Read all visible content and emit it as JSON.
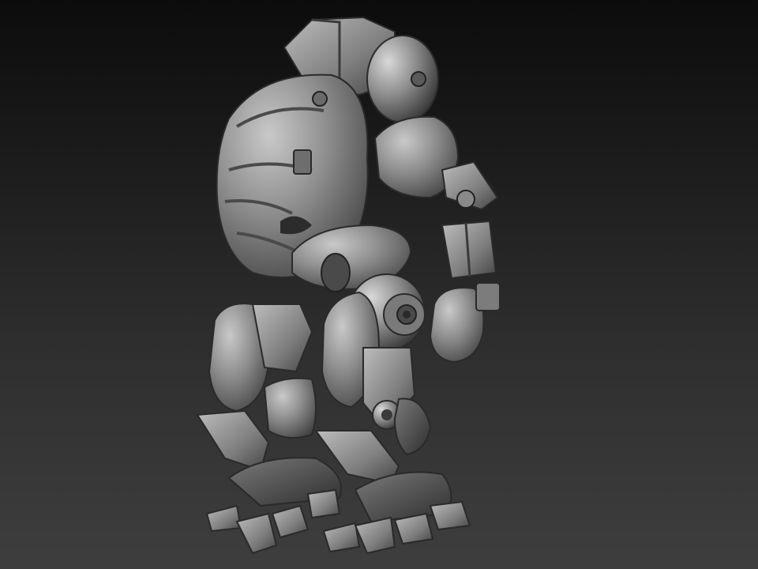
{
  "scene": {
    "subject": "robot-mech-sculpt",
    "colors": {
      "background_top": "#0c0c0c",
      "background_bottom": "#3e3e3e",
      "material_base": "#8c8c8c",
      "material_highlight": "#d4d4d4",
      "material_shadow": "#3a3a3a"
    }
  }
}
